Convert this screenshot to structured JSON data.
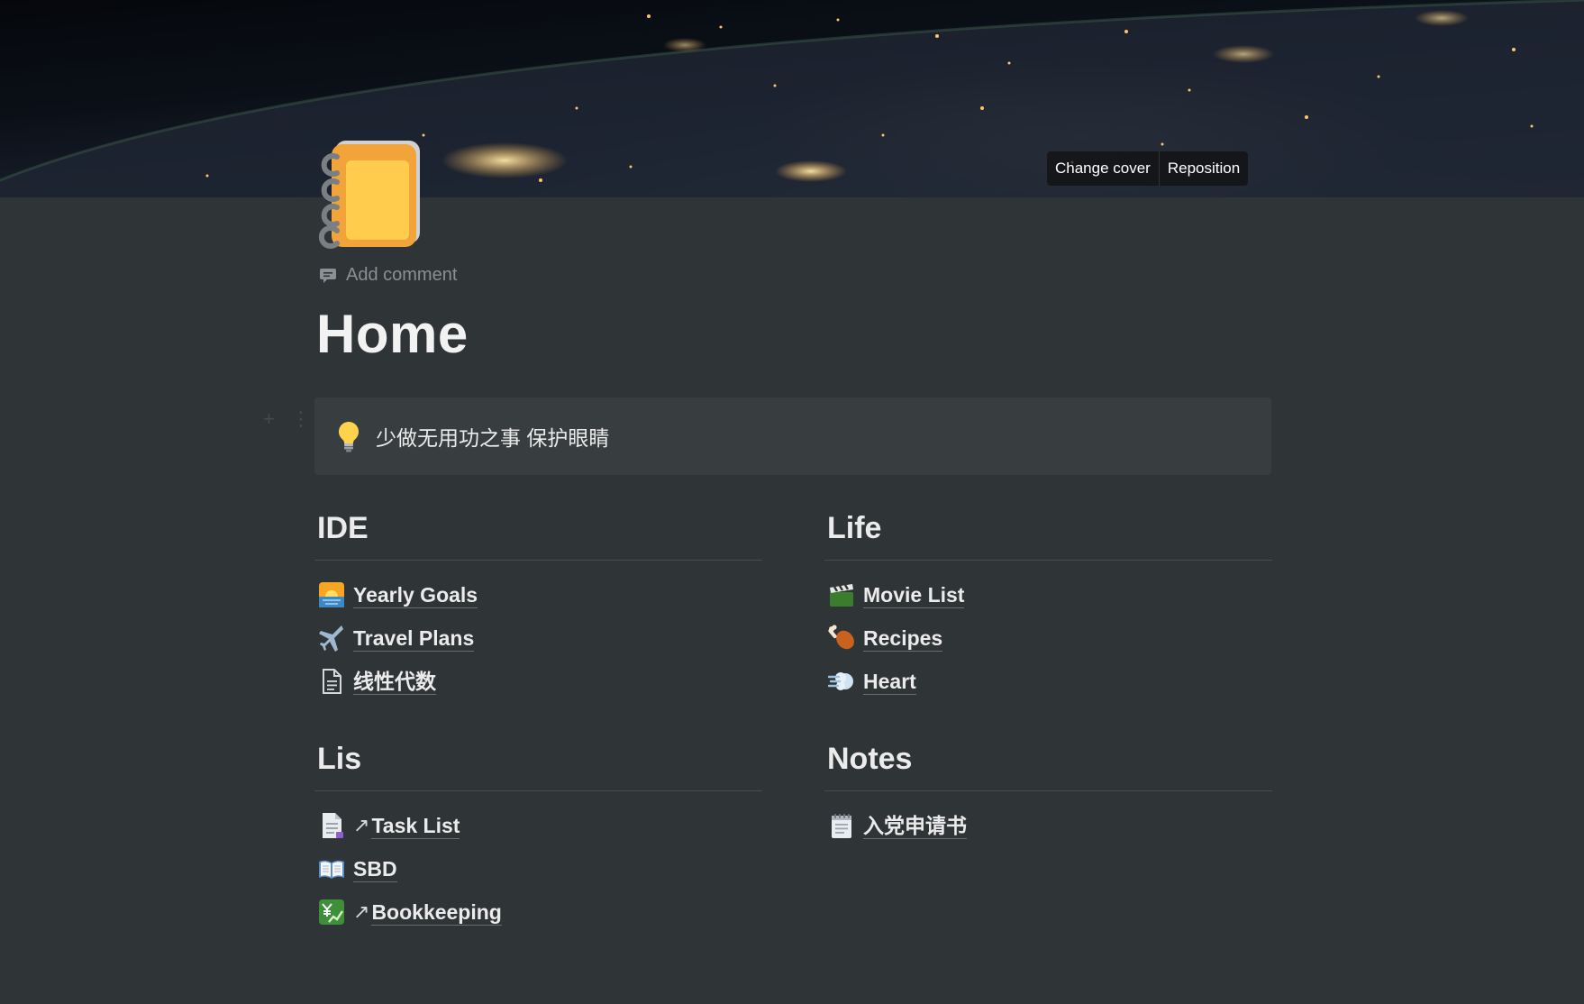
{
  "cover": {
    "change_cover_label": "Change cover",
    "reposition_label": "Reposition"
  },
  "page": {
    "icon": "notebook-icon",
    "add_comment_label": "Add comment",
    "title": "Home"
  },
  "callout": {
    "icon": "light-bulb-icon",
    "text": "少做无用功之事 保护眼睛"
  },
  "sections": {
    "ide": {
      "heading": "IDE",
      "items": [
        {
          "icon": "sunrise-icon",
          "label": "Yearly Goals"
        },
        {
          "icon": "airplane-icon",
          "label": "Travel Plans"
        },
        {
          "icon": "page-icon",
          "label": "线性代数"
        }
      ]
    },
    "life": {
      "heading": "Life",
      "items": [
        {
          "icon": "clapper-board-icon",
          "label": "Movie List"
        },
        {
          "icon": "drumstick-icon",
          "label": "Recipes"
        },
        {
          "icon": "dash-icon",
          "label": "Heart"
        }
      ]
    },
    "lis": {
      "heading": "Lis",
      "items": [
        {
          "icon": "page-facing-up-icon",
          "label": "Task List",
          "arrow": "↗"
        },
        {
          "icon": "open-book-icon",
          "label": "SBD"
        },
        {
          "icon": "yen-chart-icon",
          "label": "Bookkeeping",
          "arrow": "↗"
        }
      ]
    },
    "notes": {
      "heading": "Notes",
      "items": [
        {
          "icon": "notepad-icon",
          "label": "入党申请书"
        }
      ]
    }
  },
  "colors": {
    "background": "#2f3437",
    "callout_background": "#383d40",
    "text": "#ebebeb",
    "muted_text": "#8c8f93"
  }
}
